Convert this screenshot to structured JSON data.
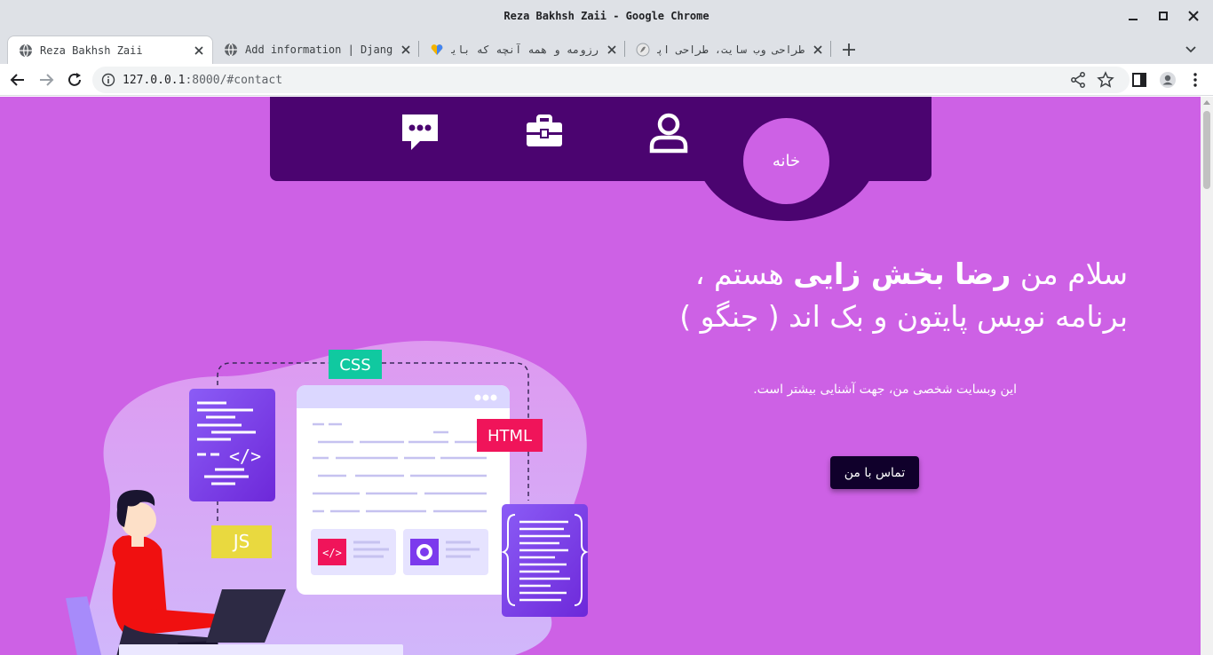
{
  "window": {
    "title": "Reza Bakhsh Zaii - Google Chrome"
  },
  "tabs": [
    {
      "label": "Reza Bakhsh Zaii",
      "active": true
    },
    {
      "label": "Add information | Django",
      "active": false
    },
    {
      "label": "رزومه و همه آنچه که باید درباره",
      "active": false
    },
    {
      "label": "طراحی وب سایت، طراحی اپلیک",
      "active": false
    }
  ],
  "toolbar": {
    "url_host": "127.0.0.1",
    "url_rest": ":8000/#contact"
  },
  "nav": {
    "home_label": "خانه",
    "icons": [
      "chat-icon",
      "briefcase-icon",
      "user-icon"
    ]
  },
  "hero": {
    "greeting_pre": "سلام من ",
    "name": "رضا بخش زایی",
    "greeting_post": " هستم ،",
    "line2": "برنامه نویس پایتون و بک اند ( جنگو )",
    "subtitle": "این وبسایت شخصی من، جهت آشنایی بیشتر است.",
    "contact_button": "تماس با من"
  },
  "illustration": {
    "badges": [
      "CSS",
      "HTML",
      "JS"
    ],
    "code_glyph": "</>"
  },
  "colors": {
    "page_bg": "#cd61e5",
    "nav_bg": "#4b0470",
    "button_bg": "#10002b"
  }
}
